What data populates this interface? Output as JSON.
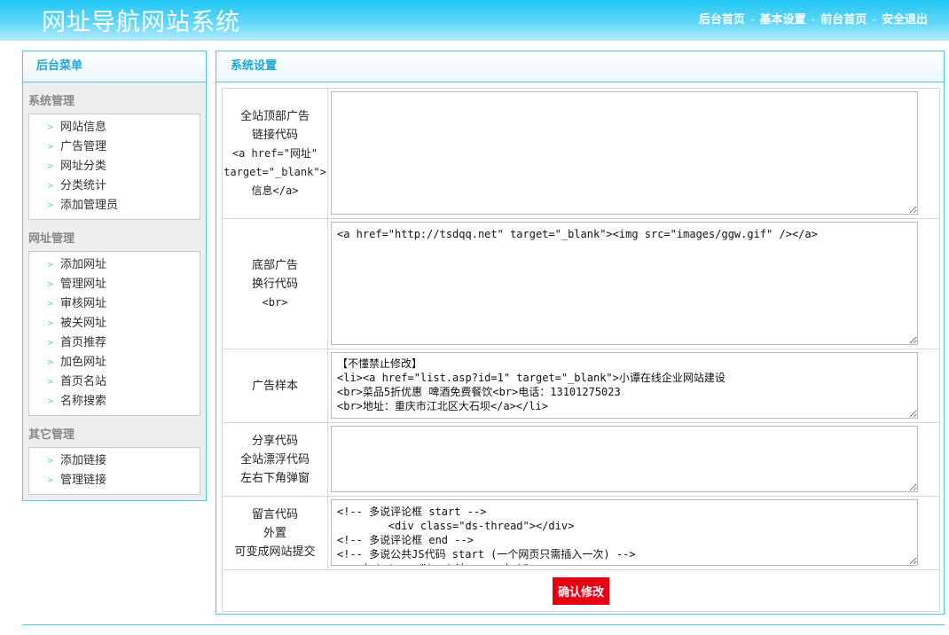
{
  "header": {
    "logo": "网址导航网站系统",
    "nav": [
      "后台首页",
      "基本设置",
      "前台首页",
      "安全退出"
    ],
    "separator": "-"
  },
  "sidebar": {
    "title": "后台菜单",
    "groups": [
      {
        "title": "系统管理",
        "items": [
          "网站信息",
          "广告管理",
          "网址分类",
          "分类统计",
          "添加管理员"
        ]
      },
      {
        "title": "网址管理",
        "items": [
          "添加网址",
          "管理网址",
          "审核网址",
          "被关网址",
          "首页推荐",
          "加色网址",
          "首页名站",
          "名称搜索"
        ]
      },
      {
        "title": "其它管理",
        "items": [
          "添加链接",
          "管理链接"
        ]
      }
    ]
  },
  "main": {
    "title": "系统设置",
    "rows": [
      {
        "label_lines": [
          "全站顶部广告",
          "链接代码",
          "<a href=\"网址\"",
          "target=\"_blank\">",
          "信息</a>"
        ],
        "value": ""
      },
      {
        "label_lines": [
          "底部广告",
          "换行代码",
          "<br>"
        ],
        "value": "<a href=\"http://tsdqq.net\" target=\"_blank\"><img src=\"images/ggw.gif\" /></a>"
      },
      {
        "label_lines": [
          "广告样本"
        ],
        "value": "【不懂禁止修改】\n<li><a href=\"list.asp?id=1\" target=\"_blank\">小谭在线企业网站建设\n<br>菜品5折优惠 啤酒免费餐饮<br>电话：13101275023\n<br>地址：重庆市江北区大石坝</a></li>"
      },
      {
        "label_lines": [
          "分享代码",
          "全站漂浮代码",
          "左右下角弹窗"
        ],
        "value": ""
      },
      {
        "label_lines": [
          "留言代码",
          "外置",
          "可变成网站提交"
        ],
        "value": "<!-- 多说评论框 start -->\n        <div class=\"ds-thread\"></div>\n<!-- 多说评论框 end -->\n<!-- 多说公共JS代码 start (一个网页只需插入一次) -->\n<script type=\"text/javascript\">"
      }
    ],
    "submit_label": "确认修改"
  },
  "colors": {
    "accent": "#4fc7ec",
    "header": "#22c6f4",
    "submit": "#e60012"
  }
}
